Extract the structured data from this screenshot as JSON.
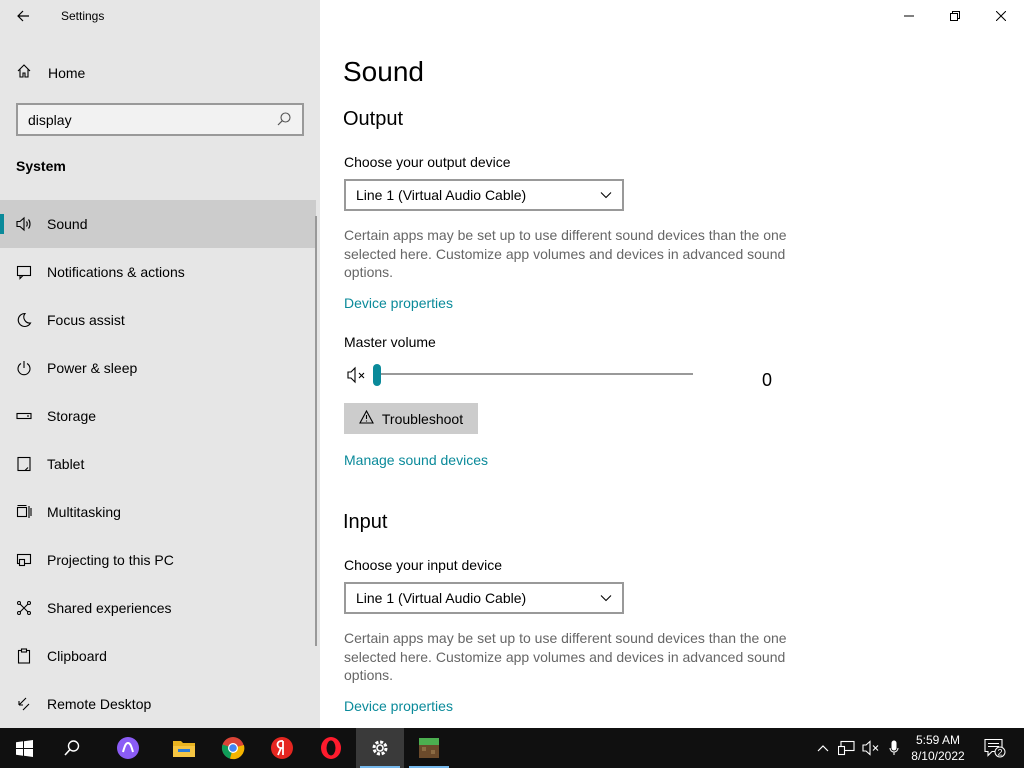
{
  "window": {
    "title": "Settings",
    "controls": {
      "minimize": "—",
      "maximize": "❐",
      "close": "✕"
    }
  },
  "sidebar": {
    "home_label": "Home",
    "search": {
      "value": "display",
      "placeholder": ""
    },
    "section_label": "System",
    "items": [
      {
        "label": "Sound",
        "icon": "speaker-icon",
        "active": true
      },
      {
        "label": "Notifications & actions",
        "icon": "notification-icon"
      },
      {
        "label": "Focus assist",
        "icon": "moon-icon"
      },
      {
        "label": "Power & sleep",
        "icon": "power-icon"
      },
      {
        "label": "Storage",
        "icon": "storage-icon"
      },
      {
        "label": "Tablet",
        "icon": "tablet-icon"
      },
      {
        "label": "Multitasking",
        "icon": "multitasking-icon"
      },
      {
        "label": "Projecting to this PC",
        "icon": "projecting-icon"
      },
      {
        "label": "Shared experiences",
        "icon": "shared-icon"
      },
      {
        "label": "Clipboard",
        "icon": "clipboard-icon"
      },
      {
        "label": "Remote Desktop",
        "icon": "remote-desktop-icon"
      }
    ]
  },
  "main": {
    "title": "Sound",
    "output": {
      "heading": "Output",
      "device_label": "Choose your output device",
      "device_value": "Line 1 (Virtual Audio Cable)",
      "description": "Certain apps may be set up to use different sound devices than the one selected here. Customize app volumes and devices in advanced sound options.",
      "device_properties_link": "Device properties",
      "master_volume_label": "Master volume",
      "master_volume_value": "0",
      "master_volume_fraction": 0,
      "muted": true,
      "troubleshoot_label": "Troubleshoot",
      "manage_link": "Manage sound devices"
    },
    "input": {
      "heading": "Input",
      "device_label": "Choose your input device",
      "device_value": "Line 1 (Virtual Audio Cable)",
      "description": "Certain apps may be set up to use different sound devices than the one selected here. Customize app volumes and devices in advanced sound options.",
      "device_properties_link": "Device properties"
    }
  },
  "taskbar": {
    "apps": [
      "start-icon",
      "search-icon",
      "alice-icon",
      "file-explorer-icon",
      "chrome-icon",
      "yandex-browser-icon",
      "opera-icon",
      "settings-icon",
      "minecraft-icon"
    ],
    "clock_time": "5:59 AM",
    "clock_date": "8/10/2022",
    "notification_count": "2"
  },
  "colors": {
    "accent": "#0a8a9a",
    "sidebar_bg": "#e6e6e6",
    "taskbar_bg": "#101010"
  }
}
